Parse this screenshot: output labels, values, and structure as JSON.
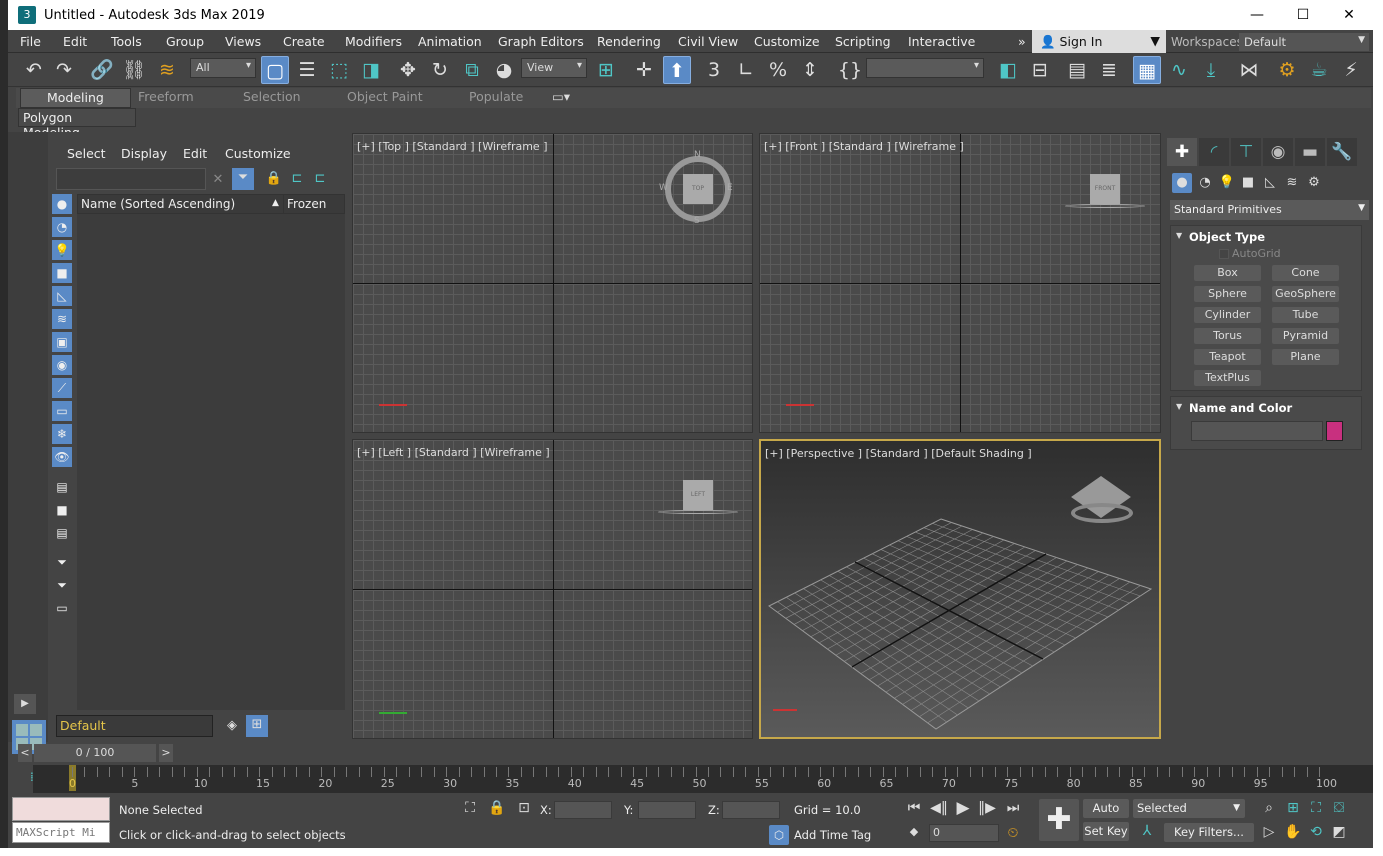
{
  "window": {
    "title": "Untitled - Autodesk 3ds Max 2019",
    "app_icon": "3",
    "minimize": "—",
    "maximize": "☐",
    "close": "✕"
  },
  "menu": [
    "File",
    "Edit",
    "Tools",
    "Group",
    "Views",
    "Create",
    "Modifiers",
    "Animation",
    "Graph Editors",
    "Rendering",
    "Civil View",
    "Customize",
    "Scripting",
    "Interactive"
  ],
  "menu_overflow": "»",
  "account": {
    "sign_in": "Sign In",
    "workspaces_label": "Workspaces:",
    "workspace": "Default"
  },
  "toolbar": {
    "selection_filter": "All",
    "ref_coord": "View",
    "named_selection": "",
    "icons": [
      "undo-icon",
      "redo-icon",
      "link-icon",
      "unlink-icon",
      "bind-spacewarp-icon",
      "select-object-icon",
      "select-by-name-icon",
      "rect-selection-icon",
      "window-crossing-icon",
      "move-icon",
      "rotate-icon",
      "scale-icon",
      "placement-icon",
      "pivot-icon",
      "manipulate-icon",
      "keyboard-shortcut-icon",
      "snap-3d-icon",
      "angle-snap-icon",
      "percent-snap-icon",
      "spinner-snap-icon",
      "named-selection-edit-icon",
      "mirror-icon",
      "align-icon",
      "scene-explorer-icon",
      "layer-explorer-icon",
      "ribbon-toggle-icon",
      "curve-editor-icon",
      "dope-sheet-icon",
      "schematic-icon",
      "render-setup-icon",
      "rendered-frame-icon",
      "render-icon"
    ]
  },
  "ribbon": {
    "tabs": [
      "Modeling",
      "Freeform",
      "Selection",
      "Object Paint",
      "Populate"
    ],
    "active": "Modeling",
    "panel": "Polygon Modeling"
  },
  "explorer": {
    "menus": [
      "Select",
      "Display",
      "Edit",
      "Customize"
    ],
    "search": "",
    "columns": [
      "Name (Sorted Ascending)",
      "Frozen"
    ],
    "sort_indicator": "▲",
    "layer": "Default"
  },
  "viewports": [
    {
      "label": "[+] [Top ] [Standard ] [Wireframe ]",
      "cube": "TOP",
      "compass": [
        "N",
        "S",
        "E",
        "W"
      ]
    },
    {
      "label": "[+] [Front ] [Standard ] [Wireframe ]",
      "cube": "FRONT"
    },
    {
      "label": "[+] [Left ] [Standard ] [Wireframe ]",
      "cube": "LEFT"
    },
    {
      "label": "[+] [Perspective ] [Standard ] [Default Shading ]",
      "cube": "",
      "active": true
    }
  ],
  "command_panel": {
    "tabs": [
      "create",
      "modify",
      "hierarchy",
      "motion",
      "display",
      "utilities"
    ],
    "category": "Standard Primitives",
    "object_type": {
      "title": "Object Type",
      "autogrid": "AutoGrid",
      "buttons": [
        "Box",
        "Cone",
        "Sphere",
        "GeoSphere",
        "Cylinder",
        "Tube",
        "Torus",
        "Pyramid",
        "Teapot",
        "Plane",
        "TextPlus"
      ]
    },
    "name_color": {
      "title": "Name and Color",
      "name": "",
      "color": "#c8307f"
    }
  },
  "timeline": {
    "frame": "0 / 100",
    "prev": "<",
    "next": ">",
    "ticks": [
      0,
      5,
      10,
      15,
      20,
      25,
      30,
      35,
      40,
      45,
      50,
      55,
      60,
      65,
      70,
      75,
      80,
      85,
      90,
      95,
      100
    ],
    "current": 0
  },
  "status": {
    "maxscript": "MAXScript Mi",
    "selection": "None Selected",
    "prompt": "Click or click-and-drag to select objects",
    "x_label": "X:",
    "y_label": "Y:",
    "z_label": "Z:",
    "x": "",
    "y": "",
    "z": "",
    "grid": "Grid = 10.0",
    "add_time_tag": "Add Time Tag",
    "frame_value": "0",
    "auto_key": "Auto Key",
    "set_key": "Set Key",
    "key_mode": "Selected",
    "key_filters": "Key Filters..."
  }
}
